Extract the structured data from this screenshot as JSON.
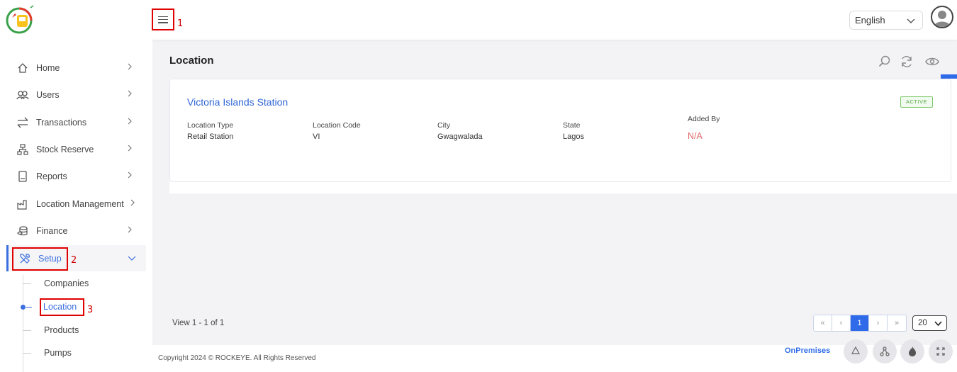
{
  "header": {
    "hamburger_annotation": "1",
    "language": "English"
  },
  "sidebar": {
    "items": [
      {
        "label": "Home",
        "icon": "home-icon"
      },
      {
        "label": "Users",
        "icon": "users-icon"
      },
      {
        "label": "Transactions",
        "icon": "transfer-icon"
      },
      {
        "label": "Stock Reserve",
        "icon": "hierarchy-icon"
      },
      {
        "label": "Reports",
        "icon": "report-icon"
      },
      {
        "label": "Location Management",
        "icon": "factory-icon"
      },
      {
        "label": "Finance",
        "icon": "coins-icon"
      },
      {
        "label": "Setup",
        "icon": "tools-icon",
        "annotation": "2"
      }
    ],
    "setup_sub": [
      {
        "label": "Companies"
      },
      {
        "label": "Location",
        "annotation": "3"
      },
      {
        "label": "Products"
      },
      {
        "label": "Pumps"
      }
    ]
  },
  "main": {
    "title": "Location",
    "card": {
      "name": "Victoria Islands Station",
      "status": "ACTIVE",
      "fields": [
        {
          "label": "Location Type",
          "value": "Retail Station"
        },
        {
          "label": "Location Code",
          "value": "VI"
        },
        {
          "label": "City",
          "value": "Gwagwalada"
        },
        {
          "label": "State",
          "value": "Lagos"
        },
        {
          "label": "Added By",
          "value": "N/A"
        }
      ]
    },
    "pagination": {
      "view_text": "View 1 - 1 of 1",
      "first": "«",
      "prev": "‹",
      "current": "1",
      "next": "›",
      "last": "»",
      "per_page": "20"
    }
  },
  "footer": {
    "copyright": "Copyright 2024 © ROCKEYE. All Rights Reserved",
    "mode": "OnPremises"
  },
  "colors": {
    "accent": "#2f6be8",
    "annotation": "#e00000",
    "active_badge": "#5aa94a",
    "na_text": "#e26a6a"
  }
}
